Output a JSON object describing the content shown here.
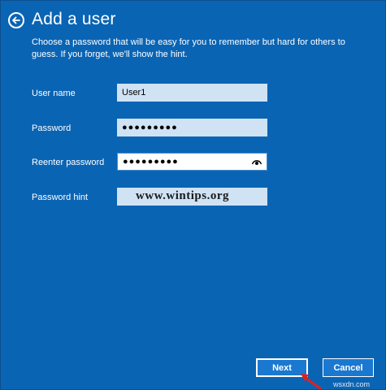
{
  "header": {
    "back_icon": "back-arrow-icon",
    "title": "Add a user",
    "subtitle": "Choose a password that will be easy for you to remember but hard for others to guess. If you forget, we'll show the hint."
  },
  "form": {
    "username": {
      "label": "User name",
      "value": "User1"
    },
    "password": {
      "label": "Password",
      "value": "●●●●●●●●●"
    },
    "reenter": {
      "label": "Reenter password",
      "value": "●●●●●●●●●",
      "reveal_icon": "eye-icon"
    },
    "hint": {
      "label": "Password hint",
      "value": ""
    }
  },
  "watermark": "www.wintips.org",
  "buttons": {
    "next": "Next",
    "cancel": "Cancel"
  },
  "annotation_arrow": {
    "color": "#e02020"
  },
  "site_mark": "wsxdn.com",
  "colors": {
    "background": "#0a64b4",
    "field": "#cfe3f5",
    "button": "#1b78d0"
  }
}
